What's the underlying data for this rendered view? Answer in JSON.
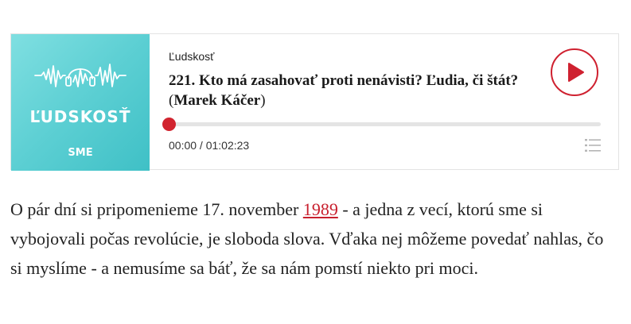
{
  "podcast": {
    "cover": {
      "title": "ĽUDSKOSŤ",
      "brand": "SME",
      "gradient_start": "#7fdfe1",
      "gradient_end": "#3fc0c6",
      "icon": "sound-wave-headphones-icon"
    },
    "show_name": "Ľudskosť",
    "episode_title": "221. Kto má zasahovať proti nenávisti? Ľudia, či štát?",
    "paren_open": "(",
    "author": "Marek Káčer",
    "paren_close": ")",
    "play_icon": "play-icon",
    "accent_color": "#cf2130",
    "progress_fraction": 0.0,
    "time_current": "00:00",
    "time_separator": " / ",
    "time_total": "01:02:23",
    "list_icon": "playlist-icon"
  },
  "article": {
    "text_before": "O pár dní si pripomenieme 17. november ",
    "link_text": "1989",
    "text_after": " - a jedna z vecí, ktorú sme si vybojovali počas revolúcie, je sloboda slova. Vďaka nej môžeme povedať nahlas, čo si myslíme - a nemusíme sa báť, že sa nám pomstí niekto pri moci."
  }
}
